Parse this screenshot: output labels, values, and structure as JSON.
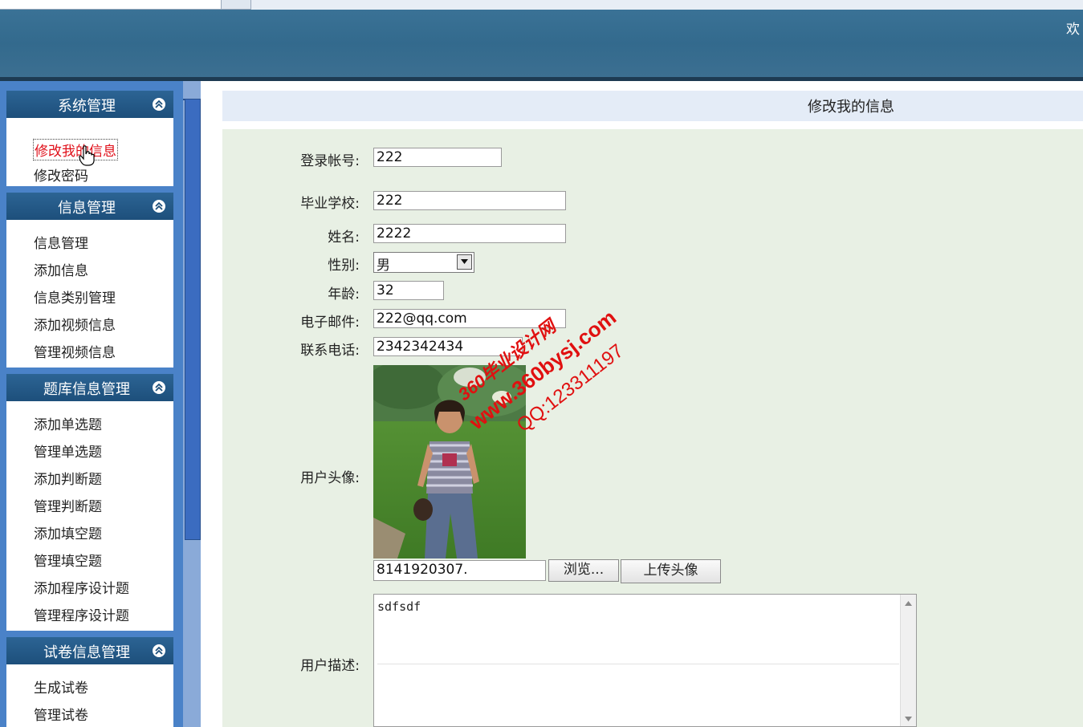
{
  "header": {
    "welcome": "欢"
  },
  "sidebar": {
    "groups": [
      {
        "title": "系统管理",
        "items": [
          "修改我的信息",
          "修改密码"
        ]
      },
      {
        "title": "信息管理",
        "items": [
          "信息管理",
          "添加信息",
          "信息类别管理",
          "添加视频信息",
          "管理视频信息"
        ]
      },
      {
        "title": "题库信息管理",
        "items": [
          "添加单选题",
          "管理单选题",
          "添加判断题",
          "管理判断题",
          "添加填空题",
          "管理填空题",
          "添加程序设计题",
          "管理程序设计题"
        ]
      },
      {
        "title": "试卷信息管理",
        "items": [
          "生成试卷",
          "管理试卷"
        ]
      }
    ],
    "active_item": "修改我的信息"
  },
  "main": {
    "title": "修改我的信息",
    "form": {
      "account_label": "登录帐号:",
      "account_value": "222",
      "school_label": "毕业学校:",
      "school_value": "222",
      "name_label": "姓名:",
      "name_value": "2222",
      "gender_label": "性别:",
      "gender_value": "男",
      "age_label": "年龄:",
      "age_value": "32",
      "email_label": "电子邮件:",
      "email_value": "222@qq.com",
      "phone_label": "联系电话:",
      "phone_value": "2342342434",
      "avatar_label": "用户头像:",
      "file_value": "8141920307.",
      "browse_label": "浏览...",
      "upload_label": "上传头像",
      "desc_label": "用户描述:",
      "desc_value": "sdfsdf"
    }
  },
  "watermark": {
    "line1": "360毕业设计网",
    "line2": "www.360bysj.com",
    "line3": "QQ:123311197"
  },
  "colors": {
    "header": "#336a8d",
    "sidebar": "#4a82c8",
    "menu_head": "#1d4f7b",
    "active_link": "#e0101a",
    "form_bg": "#e8f0e4",
    "watermark": "#e01010"
  }
}
